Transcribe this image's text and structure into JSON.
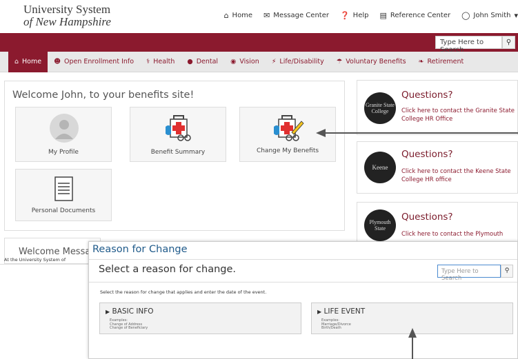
{
  "logo": {
    "line1": "University System",
    "line2": "of New Hampshire"
  },
  "topnav": {
    "home": "Home",
    "messages": "Message Center",
    "help": "Help",
    "reference": "Reference Center",
    "user": "John Smith"
  },
  "search": {
    "placeholder": "Type Here to Search"
  },
  "mainnav": [
    "Home",
    "Open Enrollment Info",
    "Health",
    "Dental",
    "Vision",
    "Life/Disability",
    "Voluntary Benefits",
    "Retirement"
  ],
  "welcome": {
    "title": "Welcome John, to your benefits site!",
    "tiles": {
      "profile": "My Profile",
      "summary": "Benefit Summary",
      "change": "Change My Benefits",
      "documents": "Personal Documents"
    }
  },
  "side": [
    {
      "q": "Questions?",
      "link": "Click here to contact the Granite State College HR Office",
      "logo": "Granite State College"
    },
    {
      "q": "Questions?",
      "link": "Click here to contact the Keene State College HR office",
      "logo": "Keene"
    },
    {
      "q": "Questions?",
      "link": "Click here to contact the Plymouth",
      "logo": "Plymouth State"
    }
  ],
  "welcome_message": {
    "title": "Welcome Messag",
    "text": "At the University System of"
  },
  "modal": {
    "title": "Reason for Change",
    "subtitle": "Select a reason for change.",
    "search_placeholder": "Type Here to Search",
    "instruction": "Select the reason for change that applies and enter the date of the event.",
    "basic": {
      "title": "BASIC INFO",
      "examples": "Examples:\nChange of Address\nChange of Beneficiary"
    },
    "life": {
      "title": "LIFE EVENT",
      "examples": "Examples:\nMarriage/Divorce\nBirth/Death"
    }
  },
  "colors": {
    "brand": "#8b1a2e",
    "modal_title": "#1f5a8a"
  }
}
